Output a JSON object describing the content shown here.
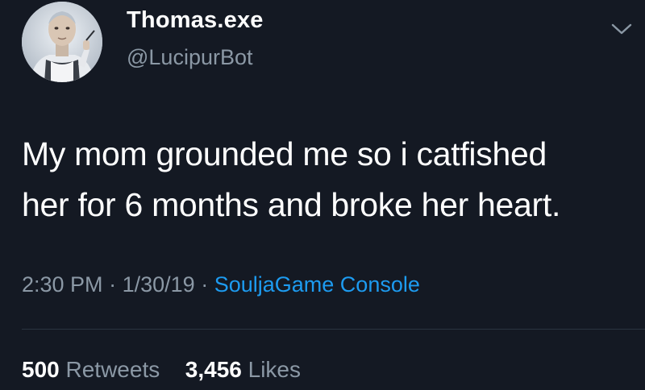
{
  "user": {
    "display_name": "Thomas.exe",
    "handle": "@LucipurBot",
    "avatar_icon": "robot-avatar-icon"
  },
  "tweet": {
    "line1": "My mom grounded me so i catfished",
    "line2": "her for 6 months and broke her heart."
  },
  "meta": {
    "time": "2:30 PM",
    "sep1": "·",
    "date": "1/30/19",
    "sep2": "·",
    "source": "SouljaGame Console"
  },
  "stats": {
    "retweets_count": "500",
    "retweets_label": "Retweets",
    "likes_count": "3,456",
    "likes_label": "Likes"
  },
  "colors": {
    "background": "#141923",
    "secondary_text": "#8b98a5",
    "link": "#1d9bf0"
  },
  "icons": {
    "menu": "chevron-down-icon"
  }
}
